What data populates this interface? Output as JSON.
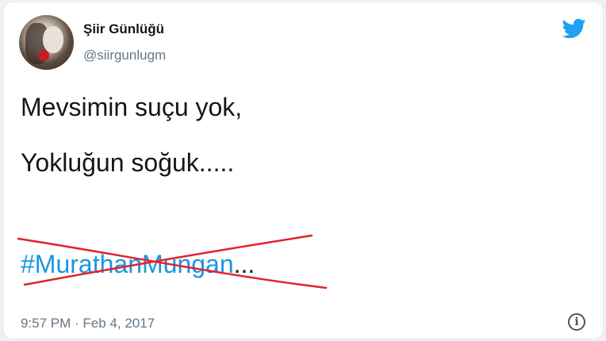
{
  "tweet": {
    "author_name": "Şiir Günlüğü",
    "author_handle": "@siirgunlugm",
    "text_line1": "Mevsimin suçu yok,",
    "text_line2": "Yokluğun soğuk.....",
    "hashtag": "#MurathanMungan",
    "trailing": "...",
    "timestamp": "9:57 PM · Feb 4, 2017"
  },
  "icons": {
    "logo": "twitter-bird-icon",
    "info": "info-icon",
    "info_glyph": "i",
    "strike": "red-x-strike"
  },
  "colors": {
    "brand": "#1da1f2",
    "hashtag": "#1b95e0",
    "text": "#14171a",
    "muted": "#657786",
    "strike": "#e0222b"
  }
}
